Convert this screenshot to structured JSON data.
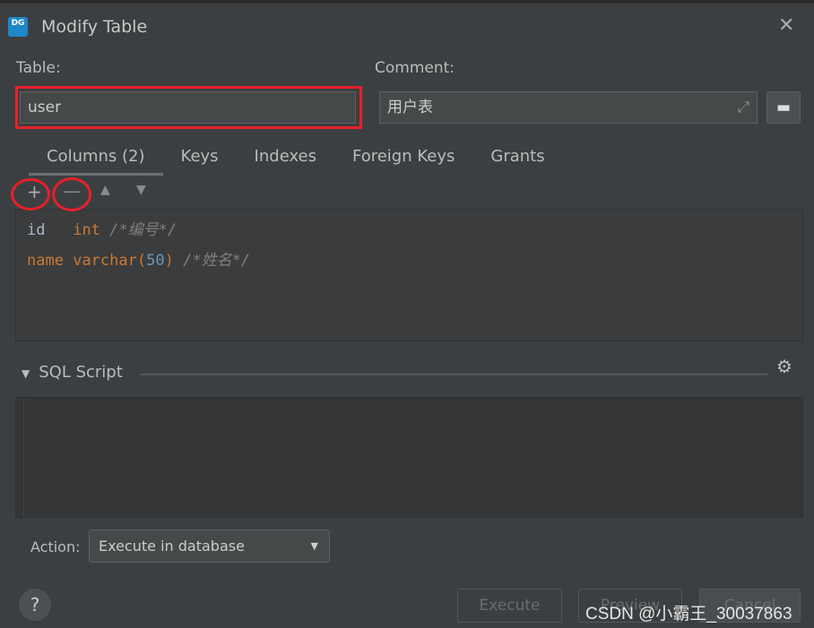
{
  "dialog": {
    "title": "Modify Table",
    "logo": "DG"
  },
  "table": {
    "label": "Table:",
    "value": "user"
  },
  "comment": {
    "label": "Comment:",
    "value": "用户表"
  },
  "tabs": [
    {
      "label": "Columns (2)"
    },
    {
      "label": "Keys"
    },
    {
      "label": "Indexes"
    },
    {
      "label": "Foreign Keys"
    },
    {
      "label": "Grants"
    }
  ],
  "columns": [
    {
      "name": "id",
      "pad": "  ",
      "type": "int",
      "args": "",
      "comment": "/*编号*/"
    },
    {
      "name": "name",
      "pad": "",
      "type": "varchar",
      "args": "50",
      "comment": "/*姓名*/"
    }
  ],
  "sql": {
    "label": "SQL Script"
  },
  "action": {
    "label": "Action:",
    "value": "Execute in database"
  },
  "buttons": {
    "execute": "Execute",
    "preview": "Preview",
    "cancel": "Cancel",
    "help": "?"
  },
  "watermark": "CSDN @小霸王_30037863",
  "colors": {
    "highlight": "#e8202a",
    "keyword": "#cc7832",
    "number": "#6897bb"
  }
}
